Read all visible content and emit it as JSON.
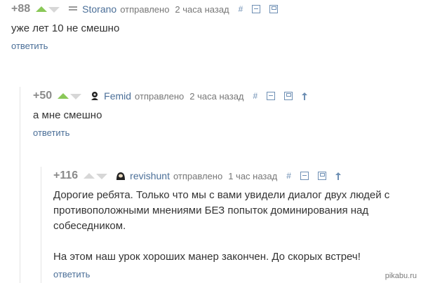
{
  "comments": [
    {
      "rating": "+88",
      "author": "Storano",
      "sent_label": "отправлено",
      "time": "2 часа назад",
      "hash": "#",
      "text": [
        "уже лет 10 не смешно"
      ],
      "reply": "ответить",
      "vote_up_active": true
    },
    {
      "rating": "+50",
      "author": "Femid",
      "sent_label": "отправлено",
      "time": "2 часа назад",
      "hash": "#",
      "text": [
        "а мне смешно"
      ],
      "reply": "ответить",
      "vote_up_active": true
    },
    {
      "rating": "+116",
      "author": "revishunt",
      "sent_label": "отправлено",
      "time": "1 час назад",
      "hash": "#",
      "text": [
        "Дорогие ребята. Только что мы с вами увидели диалог двух людей с противоположными мнениями БЕЗ попыток доминирования над собеседником.",
        "На этом наш урок хороших манер закончен. До скорых встреч!"
      ],
      "reply": "ответить",
      "vote_up_active": false
    }
  ],
  "watermark": "pikabu.ru",
  "colors": {
    "accent_green": "#8ac858",
    "link_blue": "#4b6f98",
    "muted": "#8a8a8a"
  }
}
